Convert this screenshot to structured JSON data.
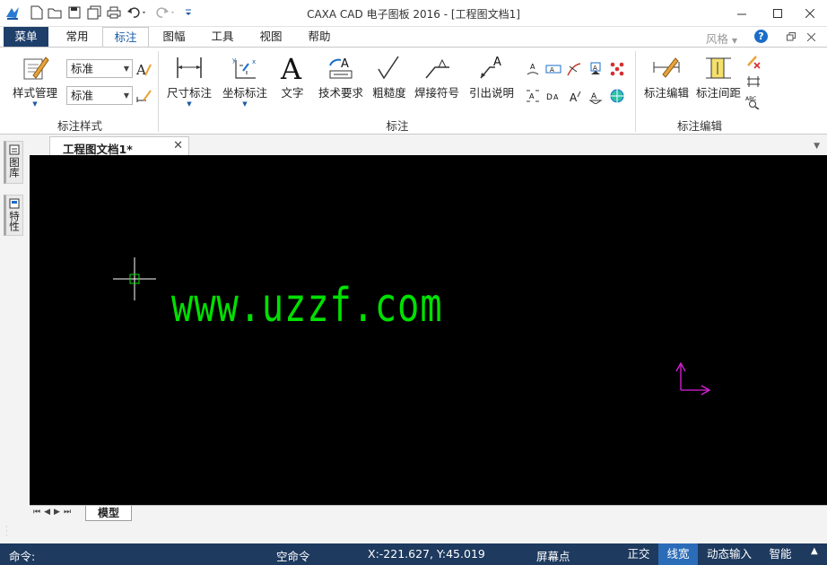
{
  "window": {
    "title": "CAXA CAD 电子图板 2016 - [工程图文档1]"
  },
  "ribbon_tabs": [
    {
      "label": "菜单"
    },
    {
      "label": "常用"
    },
    {
      "label": "标注"
    },
    {
      "label": "图幅"
    },
    {
      "label": "工具"
    },
    {
      "label": "视图"
    },
    {
      "label": "帮助"
    }
  ],
  "ribbon_right": {
    "style_label": "风格",
    "help": "?"
  },
  "groups": {
    "annotation_style": {
      "label": "标注样式",
      "style_manager": "样式管理",
      "combo1": "标准",
      "combo2": "标准"
    },
    "annotation": {
      "label": "标注",
      "buttons": [
        "尺寸标注",
        "坐标标注",
        "文字",
        "技术要求",
        "粗糙度",
        "焊接符号",
        "引出说明"
      ]
    },
    "annotation_edit": {
      "label": "标注编辑",
      "buttons": [
        "标注编辑",
        "标注间距"
      ]
    }
  },
  "side_panels": [
    "图库",
    "特性"
  ],
  "document_tab": {
    "title": "工程图文档1*"
  },
  "canvas": {
    "text": "www.uzzf.com",
    "text_color": "#00e000",
    "background": "#000000"
  },
  "layout_tab": "模型",
  "status": {
    "command_label": "命令:",
    "empty_command": "空命令",
    "coords": "X:-221.627, Y:45.019",
    "snap_mode": "屏幕点",
    "buttons": [
      {
        "label": "正交",
        "on": false
      },
      {
        "label": "线宽",
        "on": true
      },
      {
        "label": "动态输入",
        "on": false
      },
      {
        "label": "智能",
        "on": false
      }
    ]
  },
  "colors": {
    "accent": "#1a5aa6",
    "status_bg": "#1e3a5f",
    "status_on": "#2b6cb8",
    "menu_tab_bg": "#1f3f6b"
  }
}
